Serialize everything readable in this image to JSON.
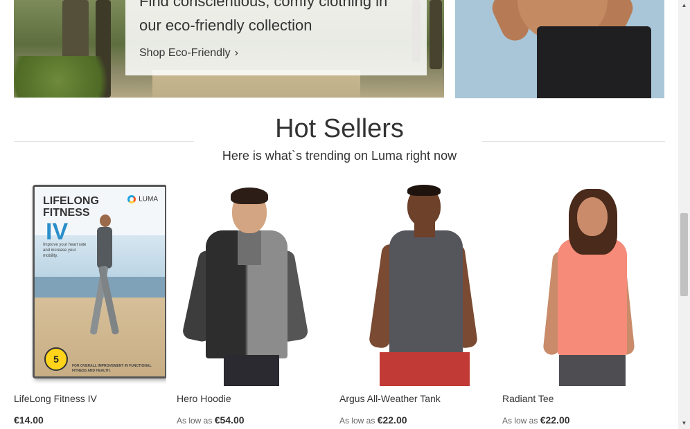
{
  "promo": {
    "line1": "Find conscientious, comfy clothing in",
    "line2": "our eco-friendly collection",
    "link_label": "Shop Eco-Friendly",
    "link_icon": "chevron-right-icon"
  },
  "hot_sellers": {
    "title": "Hot Sellers",
    "subtitle": "Here is what`s trending on Luma right now"
  },
  "products": [
    {
      "name": "LifeLong Fitness IV",
      "price_prefix": "",
      "price": "€14.00",
      "dvd": {
        "title_line1": "LIFELONG",
        "title_line2": "FITNESS",
        "roman": "IV",
        "brand": "LUMA",
        "tagline": "Improve your heart rate and increase your mobility.",
        "badge": "5",
        "footer": "FOR OVERALL IMPROVEMENT IN FUNCTIONAL FITNESS AND HEALTH."
      }
    },
    {
      "name": "Hero Hoodie",
      "price_prefix": "As low as",
      "price": "€54.00"
    },
    {
      "name": "Argus All-Weather Tank",
      "price_prefix": "As low as",
      "price": "€22.00"
    },
    {
      "name": "Radiant Tee",
      "price_prefix": "As low as",
      "price": "€22.00"
    }
  ],
  "scrollbar": {
    "up_arrow": "▲",
    "down_arrow": "▼"
  }
}
